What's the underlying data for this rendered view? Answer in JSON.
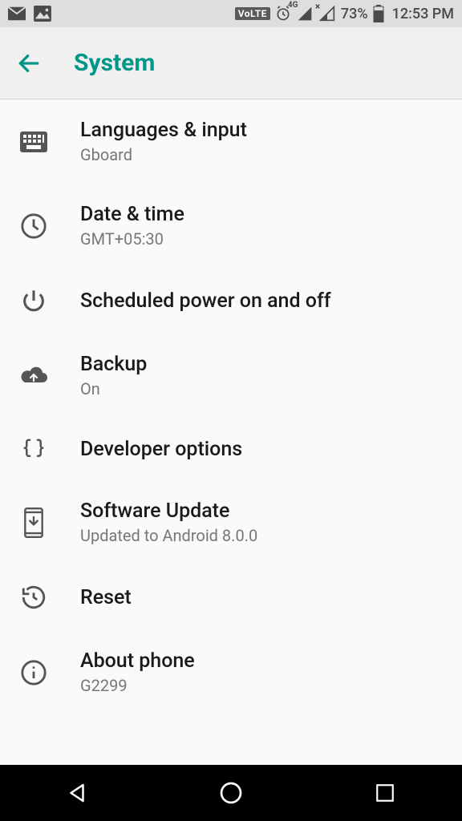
{
  "statusbar": {
    "volte": "VoLTE",
    "network_gen": "4G",
    "battery_pct": "73%",
    "time": "12:53 PM"
  },
  "header": {
    "title": "System"
  },
  "items": {
    "languages": {
      "title": "Languages & input",
      "sub": "Gboard"
    },
    "datetime": {
      "title": "Date & time",
      "sub": "GMT+05:30"
    },
    "power": {
      "title": "Scheduled power on and off"
    },
    "backup": {
      "title": "Backup",
      "sub": "On"
    },
    "dev": {
      "title": "Developer options"
    },
    "update": {
      "title": "Software Update",
      "sub": "Updated to Android 8.0.0"
    },
    "reset": {
      "title": "Reset"
    },
    "about": {
      "title": "About phone",
      "sub": "G2299"
    }
  }
}
